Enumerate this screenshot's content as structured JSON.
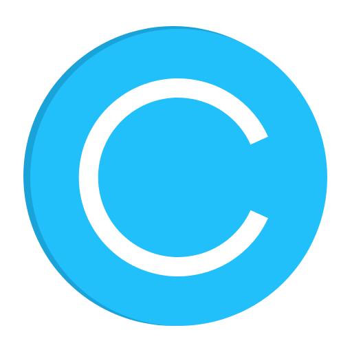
{
  "icon": {
    "name": "copyright-icon",
    "glyph": "C",
    "colors": {
      "background": "#ffffff",
      "circle": "#22c0fb",
      "circle_shadow": "#1aa3d9",
      "glyph": "#ffffff"
    }
  }
}
